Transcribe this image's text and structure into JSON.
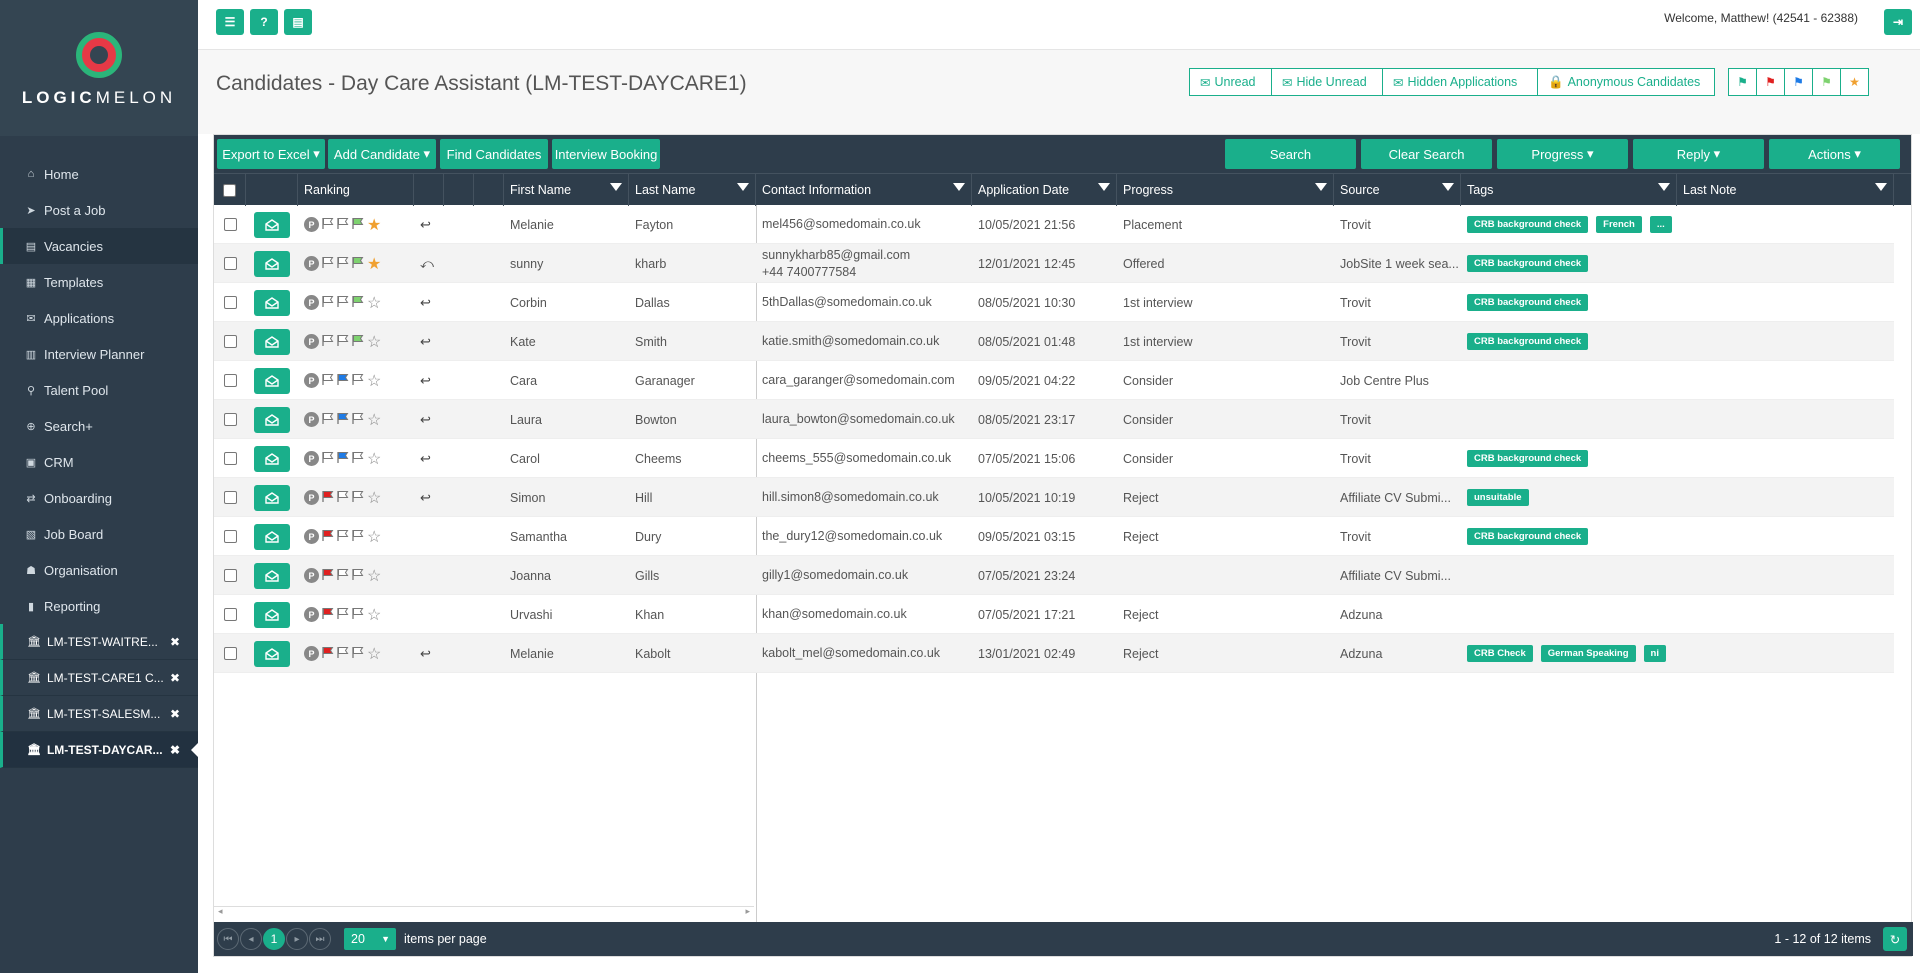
{
  "brand": {
    "name_bold": "LOGIC",
    "name_light": "MELON"
  },
  "topbar": {
    "welcome": "Welcome, Matthew! (42541 - 62388)"
  },
  "page": {
    "title": "Candidates - Day Care Assistant (LM-TEST-DAYCARE1)"
  },
  "filters": [
    "Unread",
    "Hide Unread",
    "Hidden Applications",
    "Anonymous Candidates"
  ],
  "flag_filter_colors": [
    "#1aaf8b",
    "#e02020",
    "#1e7be6",
    "#7ed26f",
    "#f0a030"
  ],
  "nav": [
    {
      "label": "Home",
      "icon": "home-icon",
      "glyph": "⌂"
    },
    {
      "label": "Post a Job",
      "icon": "rocket-icon",
      "glyph": "➤"
    },
    {
      "label": "Vacancies",
      "icon": "briefcase-icon",
      "glyph": "▤"
    },
    {
      "label": "Templates",
      "icon": "template-icon",
      "glyph": "▦"
    },
    {
      "label": "Applications",
      "icon": "envelope-icon",
      "glyph": "✉"
    },
    {
      "label": "Interview Planner",
      "icon": "calendar-icon",
      "glyph": "▥"
    },
    {
      "label": "Talent Pool",
      "icon": "search-icon",
      "glyph": "⚲"
    },
    {
      "label": "Search+",
      "icon": "search-plus-icon",
      "glyph": "⊕"
    },
    {
      "label": "CRM",
      "icon": "crm-icon",
      "glyph": "▣"
    },
    {
      "label": "Onboarding",
      "icon": "exchange-icon",
      "glyph": "⇄"
    },
    {
      "label": "Job Board",
      "icon": "book-icon",
      "glyph": "▧"
    },
    {
      "label": "Organisation",
      "icon": "users-icon",
      "glyph": "☗"
    },
    {
      "label": "Reporting",
      "icon": "bar-chart-icon",
      "glyph": "▮"
    }
  ],
  "vacancy_tabs": [
    "LM-TEST-WAITRE...",
    "LM-TEST-CARE1 C...",
    "LM-TEST-SALESM...",
    "LM-TEST-DAYCAR..."
  ],
  "toolbar": {
    "export": "Export to Excel",
    "add": "Add Candidate",
    "find": "Find Candidates",
    "interview": "Interview Booking",
    "search": "Search",
    "clear": "Clear Search",
    "progress": "Progress",
    "reply": "Reply",
    "actions": "Actions"
  },
  "columns": {
    "ranking": "Ranking",
    "first": "First Name",
    "last": "Last Name",
    "contact": "Contact Information",
    "date": "Application Date",
    "progress": "Progress",
    "source": "Source",
    "tags": "Tags",
    "note": "Last Note"
  },
  "rows": [
    {
      "first": "Melanie",
      "last": "Fayton",
      "email": "mel456@somedomain.co.uk",
      "phone": "",
      "date": "10/05/2021 21:56",
      "progress": "Placement",
      "source": "Trovit",
      "tags": [
        "CRB background check",
        "French",
        "..."
      ],
      "flag": "green",
      "star": true,
      "reply": "single"
    },
    {
      "first": "sunny",
      "last": "kharb",
      "email": "sunnykharb85@gmail.com",
      "phone": "+44 7400777584",
      "date": "12/01/2021 12:45",
      "progress": "Offered",
      "source": "JobSite 1 week sea...",
      "tags": [
        "CRB background check"
      ],
      "flag": "green",
      "star": true,
      "reply": "all"
    },
    {
      "first": "Corbin",
      "last": "Dallas",
      "email": "5thDallas@somedomain.co.uk",
      "phone": "",
      "date": "08/05/2021 10:30",
      "progress": "1st interview",
      "source": "Trovit",
      "tags": [
        "CRB background check"
      ],
      "flag": "green",
      "star": false,
      "reply": "single"
    },
    {
      "first": "Kate",
      "last": "Smith",
      "email": "katie.smith@somedomain.co.uk",
      "phone": "",
      "date": "08/05/2021 01:48",
      "progress": "1st interview",
      "source": "Trovit",
      "tags": [
        "CRB background check"
      ],
      "flag": "green",
      "star": false,
      "reply": "single"
    },
    {
      "first": "Cara",
      "last": "Garanager",
      "email": "cara_garanger@somedomain.com",
      "phone": "",
      "date": "09/05/2021 04:22",
      "progress": "Consider",
      "source": "Job Centre Plus",
      "tags": [],
      "flag": "blue",
      "star": false,
      "reply": "single"
    },
    {
      "first": "Laura",
      "last": "Bowton",
      "email": "laura_bowton@somedomain.co.uk",
      "phone": "",
      "date": "08/05/2021 23:17",
      "progress": "Consider",
      "source": "Trovit",
      "tags": [],
      "flag": "blue",
      "star": false,
      "reply": "single"
    },
    {
      "first": "Carol",
      "last": "Cheems",
      "email": "cheems_555@somedomain.co.uk",
      "phone": "",
      "date": "07/05/2021 15:06",
      "progress": "Consider",
      "source": "Trovit",
      "tags": [
        "CRB background check"
      ],
      "flag": "blue",
      "star": false,
      "reply": "single"
    },
    {
      "first": "Simon",
      "last": "Hill",
      "email": "hill.simon8@somedomain.co.uk",
      "phone": "",
      "date": "10/05/2021 10:19",
      "progress": "Reject",
      "source": "Affiliate CV Submi...",
      "tags": [
        "unsuitable"
      ],
      "flag": "red",
      "star": false,
      "reply": "single"
    },
    {
      "first": "Samantha",
      "last": "Dury",
      "email": "the_dury12@somedomain.co.uk",
      "phone": "",
      "date": "09/05/2021 03:15",
      "progress": "Reject",
      "source": "Trovit",
      "tags": [
        "CRB background check"
      ],
      "flag": "red",
      "star": false,
      "reply": ""
    },
    {
      "first": "Joanna",
      "last": "Gills",
      "email": "gilly1@somedomain.co.uk",
      "phone": "",
      "date": "07/05/2021 23:24",
      "progress": "",
      "source": "Affiliate CV Submi...",
      "tags": [],
      "flag": "red",
      "star": false,
      "reply": ""
    },
    {
      "first": "Urvashi",
      "last": "Khan",
      "email": "khan@somedomain.co.uk",
      "phone": "",
      "date": "07/05/2021 17:21",
      "progress": "Reject",
      "source": "Adzuna",
      "tags": [],
      "flag": "red",
      "star": false,
      "reply": ""
    },
    {
      "first": "Melanie",
      "last": "Kabolt",
      "email": "kabolt_mel@somedomain.co.uk",
      "phone": "",
      "date": "13/01/2021 02:49",
      "progress": "Reject",
      "source": "Adzuna",
      "tags": [
        "CRB Check",
        "German Speaking",
        "ni"
      ],
      "flag": "red",
      "star": false,
      "reply": "single"
    }
  ],
  "pager": {
    "current": "1",
    "page_size": "20",
    "per_page_label": "items per page",
    "summary": "1 - 12 of 12 items"
  }
}
